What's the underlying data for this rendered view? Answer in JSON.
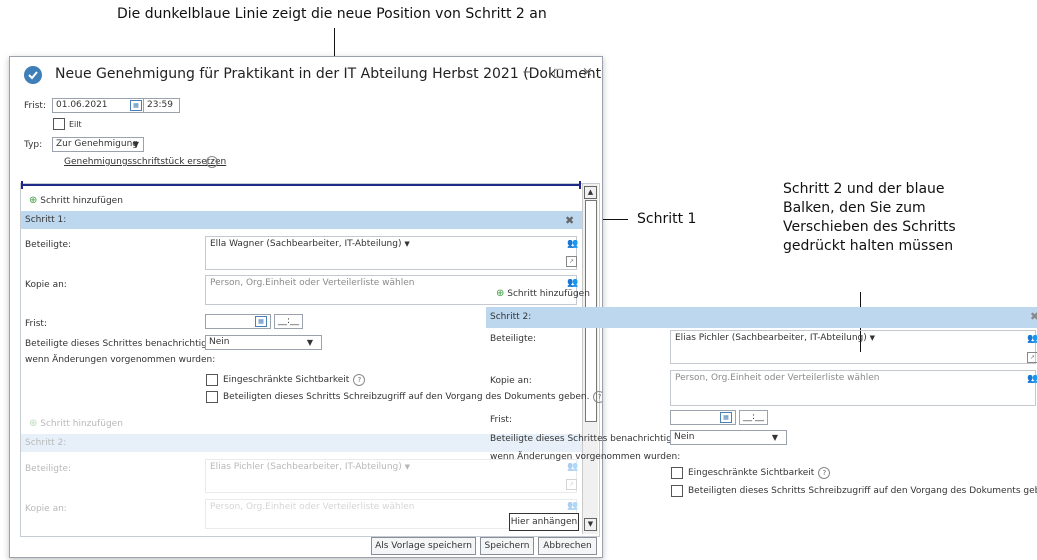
{
  "callouts": {
    "top": "Die dunkelblaue Linie zeigt die neue Position von Schritt 2 an",
    "step1": "Schritt 1",
    "step2": "Schritt 2 und der blaue Balken, den Sie zum Verschieben des Schritts gedrückt halten müssen"
  },
  "window": {
    "title": "Neue Genehmigung für Praktikant in der IT Abteilung Herbst 2021 (Dokumenten-I...",
    "minimize": "−",
    "maximize": "□",
    "close": "×"
  },
  "form": {
    "deadline_label": "Frist:",
    "deadline_date": "01.06.2021",
    "deadline_time": "23:59",
    "urgent_label": "Eilt",
    "type_label": "Typ:",
    "type_value": "Zur Genehmigung",
    "replace_link": "Genehmigungsschriftstück ersetzen"
  },
  "step1": {
    "add": "Schritt hinzufügen",
    "header": "Schritt 1:",
    "participants_label": "Beteiligte:",
    "participants_value": "Ella Wagner (Sachbearbeiter, IT-Abteilung)",
    "copy_label": "Kopie an:",
    "copy_placeholder": "Person, Org.Einheit oder Verteilerliste wählen",
    "deadline_label": "Frist:",
    "time_placeholder": "__:__",
    "notify_label_1": "Beteiligte dieses Schrittes benachrichtigen,",
    "notify_label_2": "wenn Änderungen vorgenommen wurden:",
    "notify_value": "Nein",
    "restricted": "Eingeschränkte Sichtbarkeit",
    "write_access": "Beteiligten dieses Schritts Schreibzugriff auf den Vorgang des Dokuments geben."
  },
  "step2_ghost": {
    "add": "Schritt hinzufügen",
    "header": "Schritt 2:",
    "participants_label": "Beteiligte:",
    "participants_value": "Elias Pichler (Sachbearbeiter, IT-Abteilung)",
    "copy_label": "Kopie an:",
    "copy_placeholder": "Person, Org.Einheit oder Verteilerliste wählen"
  },
  "step2_drag": {
    "add": "Schritt hinzufügen",
    "header": "Schritt 2:",
    "participants_label": "Beteiligte:",
    "participants_value": "Elias Pichler (Sachbearbeiter, IT-Abteilung)",
    "copy_label": "Kopie an:",
    "copy_placeholder": "Person, Org.Einheit oder Verteilerliste wählen",
    "deadline_label": "Frist:",
    "time_placeholder": "__:__",
    "notify_label_1": "Beteiligte dieses Schrittes benachrichtigen,",
    "notify_label_2": "wenn Änderungen vorgenommen wurden:",
    "notify_value": "Nein",
    "restricted": "Eingeschränkte Sichtbarkeit",
    "write_access": "Beteiligten dieses Schritts Schreibzugriff auf den Vorgang des Dokuments geben."
  },
  "buttons": {
    "append_here": "Hier anhängen",
    "save_template": "Als Vorlage speichern",
    "save": "Speichern",
    "cancel": "Abbrechen"
  }
}
